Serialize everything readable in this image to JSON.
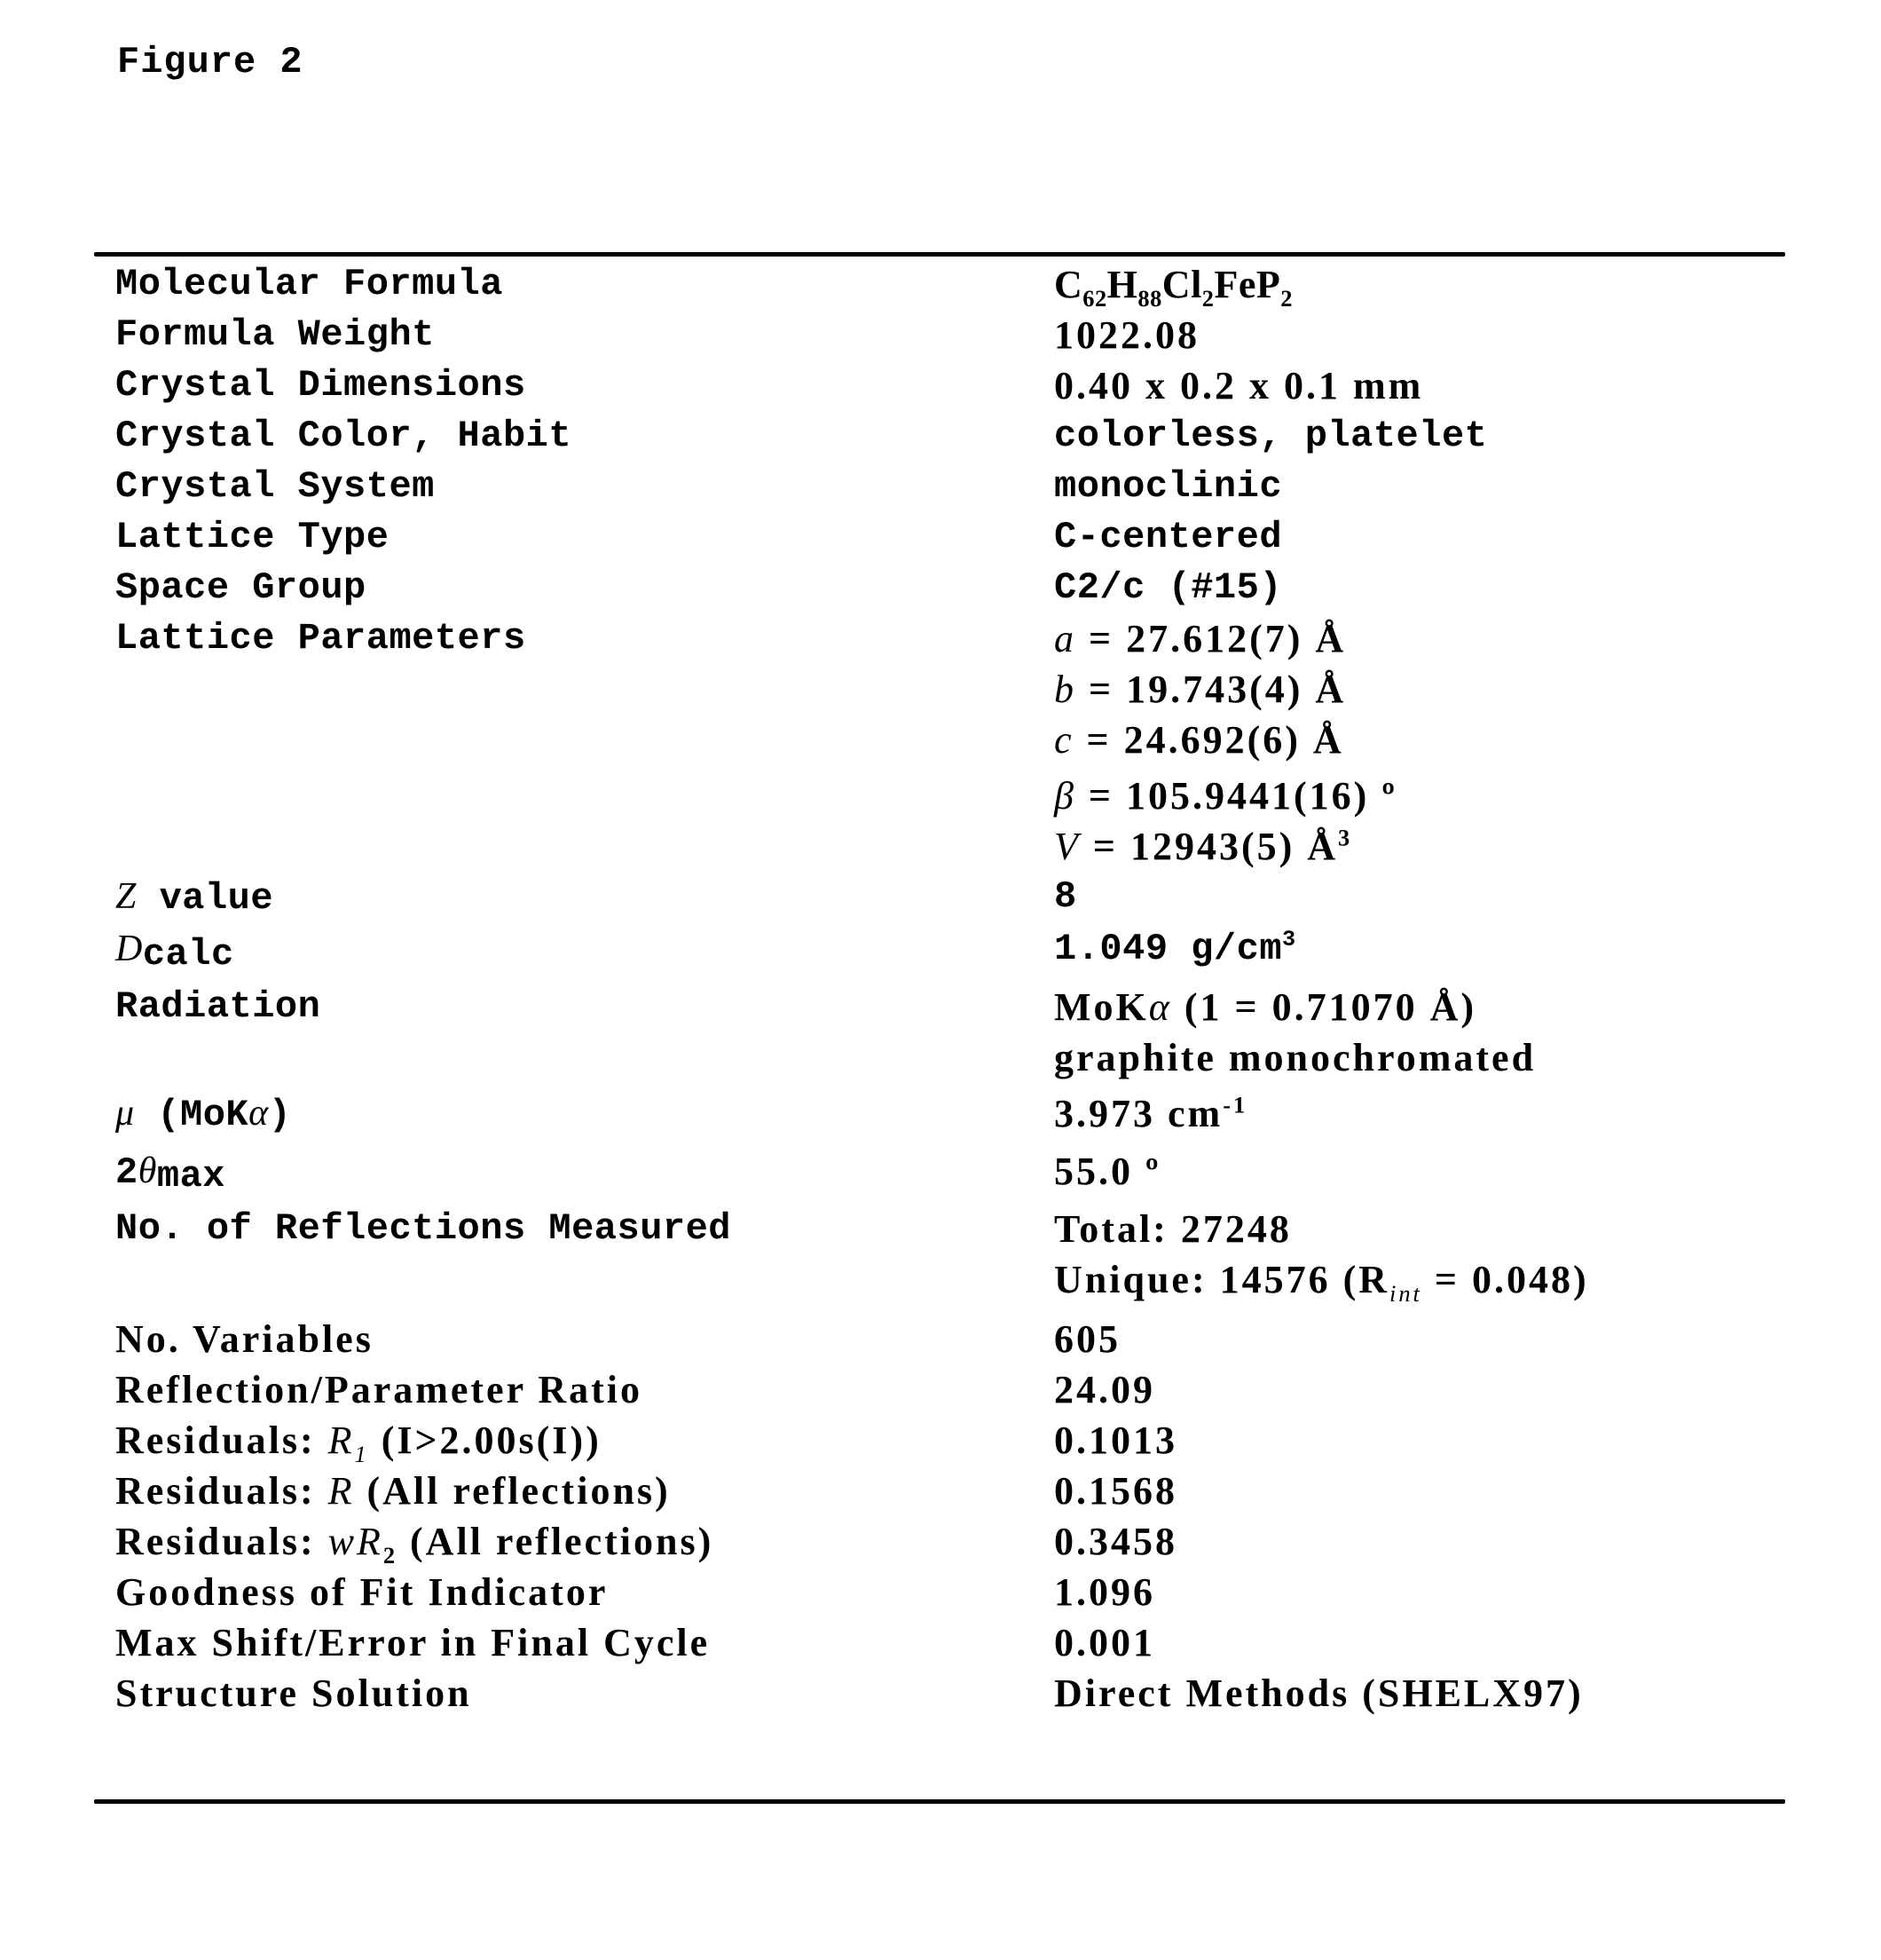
{
  "figure": {
    "title": "Figure 2"
  },
  "table": {
    "molecular_formula": {
      "label": "Molecular Formula",
      "value_parts": [
        "C",
        "62",
        "H",
        "88",
        "Cl",
        "2",
        "FeP",
        "2"
      ]
    },
    "formula_weight": {
      "label": "Formula Weight",
      "value": "1022.08"
    },
    "crystal_dimensions": {
      "label": "Crystal Dimensions",
      "value": "0.40 x 0.2 x 0.1 mm"
    },
    "crystal_color_habit": {
      "label": "Crystal Color, Habit",
      "value": "colorless, platelet"
    },
    "crystal_system": {
      "label": "Crystal System",
      "value": "monoclinic"
    },
    "lattice_type": {
      "label": "Lattice Type",
      "value": "C-centered"
    },
    "space_group": {
      "label": "Space Group",
      "value": "C2/c (#15)"
    },
    "lattice_parameters": {
      "label": "Lattice Parameters",
      "a": {
        "symbol": "a",
        "value": "= 27.612(7) Å"
      },
      "b": {
        "symbol": "b",
        "value": "= 19.743(4) Å"
      },
      "c": {
        "symbol": "c",
        "value": "= 24.692(6) Å"
      },
      "beta": {
        "symbol": "β",
        "value": "= 105.9441(16)",
        "unit": "º"
      },
      "volume": {
        "symbol": "V",
        "value": "= 12943(5) Å",
        "sup": "3"
      }
    },
    "z_value": {
      "label_symbol": "Z",
      "label_rest": " value",
      "value": "8"
    },
    "dcalc": {
      "label_symbol": "D",
      "label_rest": "calc",
      "value": "1.049 g/cm",
      "sup": "3"
    },
    "radiation": {
      "label": "Radiation",
      "value_line1_prefix": "MoK",
      "value_line1_alpha": "α",
      "value_line1_rest": " (1 = 0.71070 Å)",
      "value_line2": "graphite monochromated"
    },
    "mu": {
      "label_symbol": "μ",
      "label_rest_prefix": " (MoK",
      "label_alpha": "α",
      "label_rest_suffix": ")",
      "value": "3.973 cm",
      "sup": "-1"
    },
    "two_theta_max": {
      "label_prefix": "2",
      "label_symbol": "θ",
      "label_rest": "max",
      "value": "55.0",
      "unit": "º"
    },
    "reflections": {
      "label": "No. of Reflections Measured",
      "total": "Total: 27248",
      "unique_prefix": "Unique: 14576 (R",
      "unique_sub": "int",
      "unique_suffix": " = 0.048)"
    },
    "no_variables": {
      "label": "No. Variables",
      "value": "605"
    },
    "ratio": {
      "label": "Reflection/Parameter Ratio",
      "value": "24.09"
    },
    "residuals_r1": {
      "label_prefix": "Residuals: ",
      "label_symbol": "R",
      "label_sub": "1",
      "label_rest": " (I>2.00s(I))",
      "value": "0.1013"
    },
    "residuals_r": {
      "label_prefix": "Residuals: ",
      "label_symbol": "R",
      "label_rest": " (All reflections)",
      "value": "0.1568"
    },
    "residuals_wr2": {
      "label_prefix": "Residuals: ",
      "label_symbol": "wR",
      "label_sub": "2",
      "label_rest": " (All reflections)",
      "value": "0.3458"
    },
    "goodness_of_fit": {
      "label": "Goodness of Fit Indicator",
      "value": "1.096"
    },
    "max_shift": {
      "label": "Max Shift/Error in Final Cycle",
      "value": "0.001"
    },
    "structure_solution": {
      "label": "Structure Solution",
      "value": "Direct Methods (SHELX97)"
    }
  }
}
